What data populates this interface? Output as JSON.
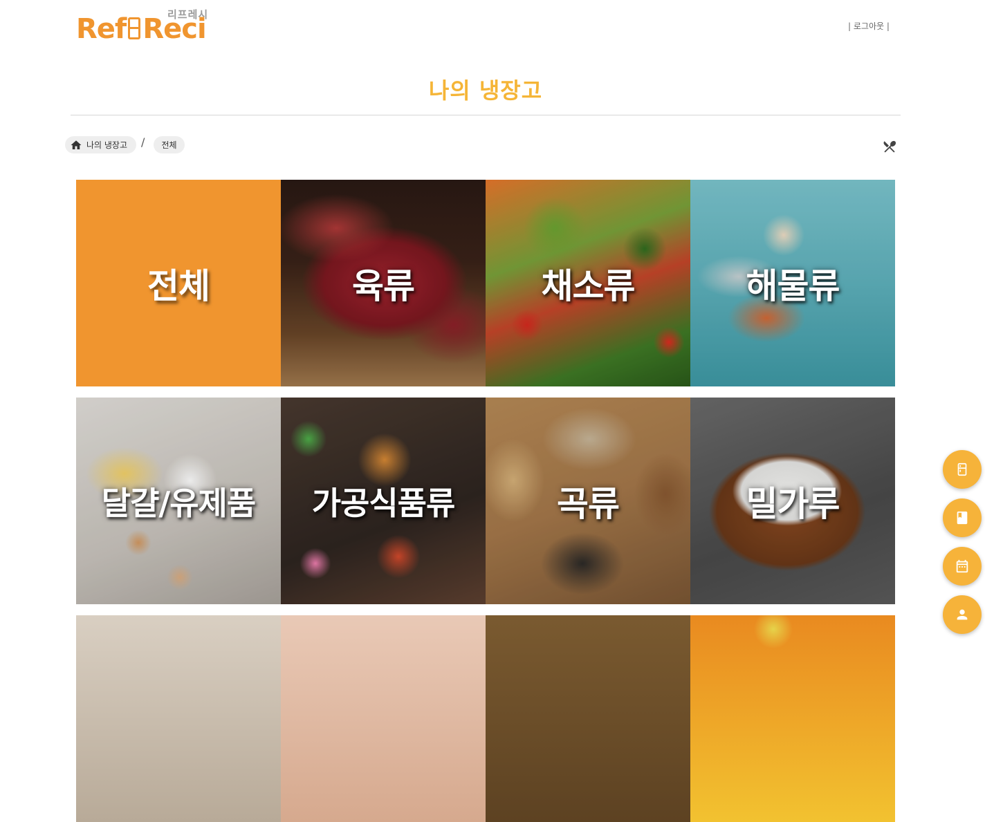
{
  "header": {
    "logo_text": "RefReci",
    "logo_subtitle": "리프레시",
    "logout": "| 로그아웃 |"
  },
  "page": {
    "title": "나의 냉장고"
  },
  "breadcrumb": {
    "home": "나의 냉장고",
    "separator": "/",
    "current": "전체"
  },
  "categories": [
    {
      "label": "전체"
    },
    {
      "label": "육류"
    },
    {
      "label": "채소류"
    },
    {
      "label": "해물류"
    },
    {
      "label": "달걀/유제품"
    },
    {
      "label": "가공식품류"
    },
    {
      "label": "곡류"
    },
    {
      "label": "밀가루"
    }
  ],
  "icons": {
    "home": "home-icon",
    "cutlery": "cutlery-icon",
    "fab": [
      "fridge-icon",
      "book-icon",
      "calendar-icon",
      "person-icon"
    ]
  },
  "colors": {
    "accent": "#f0952f",
    "title": "#f5b537",
    "fab": "#f6b33a"
  }
}
